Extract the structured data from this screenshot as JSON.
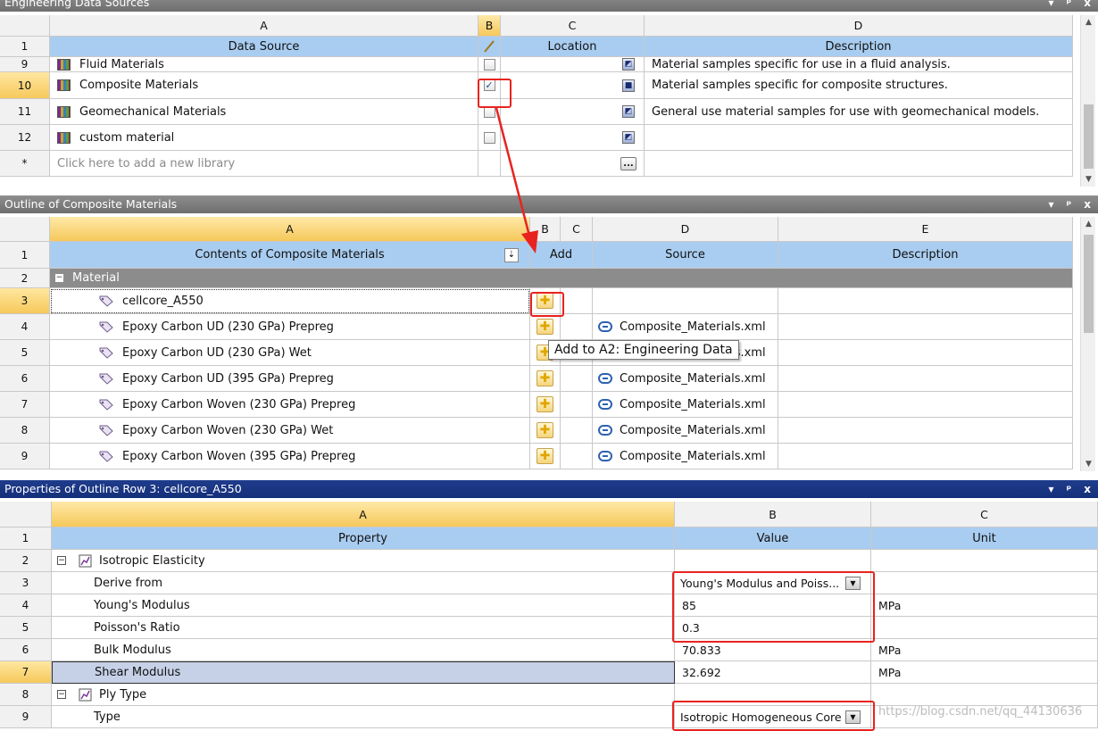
{
  "panel1": {
    "title": "Engineering Data Sources",
    "controls": [
      "▾",
      "ᵖ",
      "x"
    ],
    "col_letters": [
      "A",
      "B",
      "C",
      "D"
    ],
    "col_headers": {
      "a": "Data Source",
      "c": "Location",
      "d": "Description"
    },
    "rows": [
      {
        "num": "9",
        "name": "Fluid Materials",
        "checked": false,
        "description": "Material samples specific for use in a fluid analysis."
      },
      {
        "num": "10",
        "name": "Composite Materials",
        "checked": true,
        "description": "Material samples specific for composite structures."
      },
      {
        "num": "11",
        "name": "Geomechanical Materials",
        "checked": false,
        "description": "General use material samples for use with geomechanical models."
      },
      {
        "num": "12",
        "name": "custom material",
        "checked": false,
        "description": ""
      }
    ],
    "new_row": {
      "num": "*",
      "placeholder": "Click here to add a new library",
      "button": "..."
    },
    "header_row_num": "1"
  },
  "panel2": {
    "title": "Outline of Composite Materials",
    "controls": [
      "▾",
      "ᵖ",
      "x"
    ],
    "col_letters": [
      "A",
      "B",
      "C",
      "D",
      "E"
    ],
    "col_headers": {
      "a": "Contents of Composite Materials",
      "bc": "Add",
      "d": "Source",
      "e": "Description"
    },
    "header_row_num": "1",
    "group_row": {
      "num": "2",
      "label": "Material"
    },
    "rows": [
      {
        "num": "3",
        "name": "cellcore_A550",
        "source": ""
      },
      {
        "num": "4",
        "name": "Epoxy Carbon UD (230 GPa) Prepreg",
        "source": "Composite_Materials.xml"
      },
      {
        "num": "5",
        "name": "Epoxy Carbon UD (230 GPa) Wet",
        "source": "Composite_Materials.xml"
      },
      {
        "num": "6",
        "name": "Epoxy Carbon UD (395 GPa) Prepreg",
        "source": "Composite_Materials.xml"
      },
      {
        "num": "7",
        "name": "Epoxy Carbon Woven (230 GPa) Prepreg",
        "source": "Composite_Materials.xml"
      },
      {
        "num": "8",
        "name": "Epoxy Carbon Woven (230 GPa) Wet",
        "source": "Composite_Materials.xml"
      },
      {
        "num": "9",
        "name": "Epoxy Carbon Woven (395 GPa) Prepreg",
        "source": "Composite_Materials.xml"
      }
    ],
    "tooltip": "Add to A2: Engineering Data"
  },
  "panel3": {
    "title": "Properties of Outline Row 3: cellcore_A550",
    "controls": [
      "▾",
      "ᵖ",
      "x"
    ],
    "col_letters": [
      "A",
      "B",
      "C"
    ],
    "col_headers": {
      "a": "Property",
      "b": "Value",
      "c": "Unit"
    },
    "header_row_num": "1",
    "rows": [
      {
        "num": "2",
        "property": "Isotropic Elasticity",
        "value": "",
        "unit": "",
        "group": true
      },
      {
        "num": "3",
        "property": "Derive from",
        "value": "Young's Modulus and Poiss...",
        "unit": "",
        "dropdown": true
      },
      {
        "num": "4",
        "property": "Young's Modulus",
        "value": "85",
        "unit": "MPa"
      },
      {
        "num": "5",
        "property": "Poisson's Ratio",
        "value": "0.3",
        "unit": ""
      },
      {
        "num": "6",
        "property": "Bulk Modulus",
        "value": "70.833",
        "unit": "MPa"
      },
      {
        "num": "7",
        "property": "Shear Modulus",
        "value": "32.692",
        "unit": "MPa",
        "selected": true
      },
      {
        "num": "8",
        "property": "Ply Type",
        "value": "",
        "unit": "",
        "group": true
      },
      {
        "num": "9",
        "property": "Type",
        "value": "Isotropic Homogeneous Core",
        "unit": "",
        "dropdown": true
      }
    ]
  },
  "watermark": "https://blog.csdn.net/qq_44130636",
  "colors": {
    "accent_red": "#e8231f",
    "header_blue": "#a9cdf0",
    "selection_orange": "#f6c85b"
  }
}
